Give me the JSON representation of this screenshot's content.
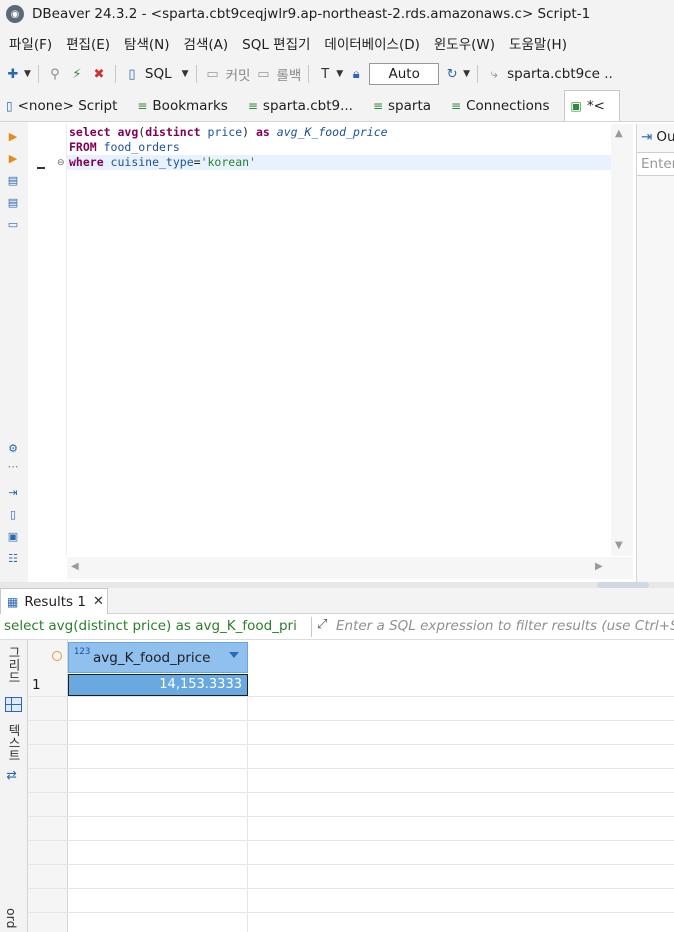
{
  "window": {
    "title": "DBeaver 24.3.2 - <sparta.cbt9ceqjwlr9.ap-northeast-2.rds.amazonaws.c> Script-1"
  },
  "menu": [
    "파일(F)",
    "편집(E)",
    "탐색(N)",
    "검색(A)",
    "SQL 편집기",
    "데이터베이스(D)",
    "윈도우(W)",
    "도움말(H)"
  ],
  "toolbar": {
    "sql_label": "SQL",
    "commit_label": "커밋",
    "rollback_label": "롤백",
    "transaction_mode": "Auto",
    "datasource_label": "sparta.cbt9ce .."
  },
  "editor_tabs": [
    {
      "label": "<none> Script"
    },
    {
      "label": "Bookmarks"
    },
    {
      "label": "sparta.cbt9..."
    },
    {
      "label": "sparta"
    },
    {
      "label": "Connections"
    },
    {
      "label": "*<"
    }
  ],
  "editor": {
    "line1": {
      "kw1": "select ",
      "fn": "avg",
      "p1": "(",
      "kw2": "distinct",
      "sp": " ",
      "col": "price",
      "p2": ") ",
      "kw3": "as ",
      "alias": "avg_K_food_price"
    },
    "line2": {
      "kw": "FROM ",
      "table": "food_orders"
    },
    "line3": {
      "kw": "where ",
      "col": "cuisine_type",
      "op": "=",
      "str": "'korean'"
    }
  },
  "outline_panel": {
    "header": "Ou",
    "input_placeholder": "Enter"
  },
  "results": {
    "tab_label": "Results 1",
    "query_text": "select avg(distinct price) as avg_K_food_pri",
    "filter_placeholder": "Enter a SQL expression to filter results (use Ctrl+Space)",
    "side_labels": {
      "grid": "그리드",
      "text": "텍스트",
      "record": "ord"
    },
    "column": {
      "type_badge": "123",
      "name": "avg_K_food_price"
    },
    "rows": [
      {
        "num": "1",
        "value": "14,153.3333"
      }
    ]
  }
}
